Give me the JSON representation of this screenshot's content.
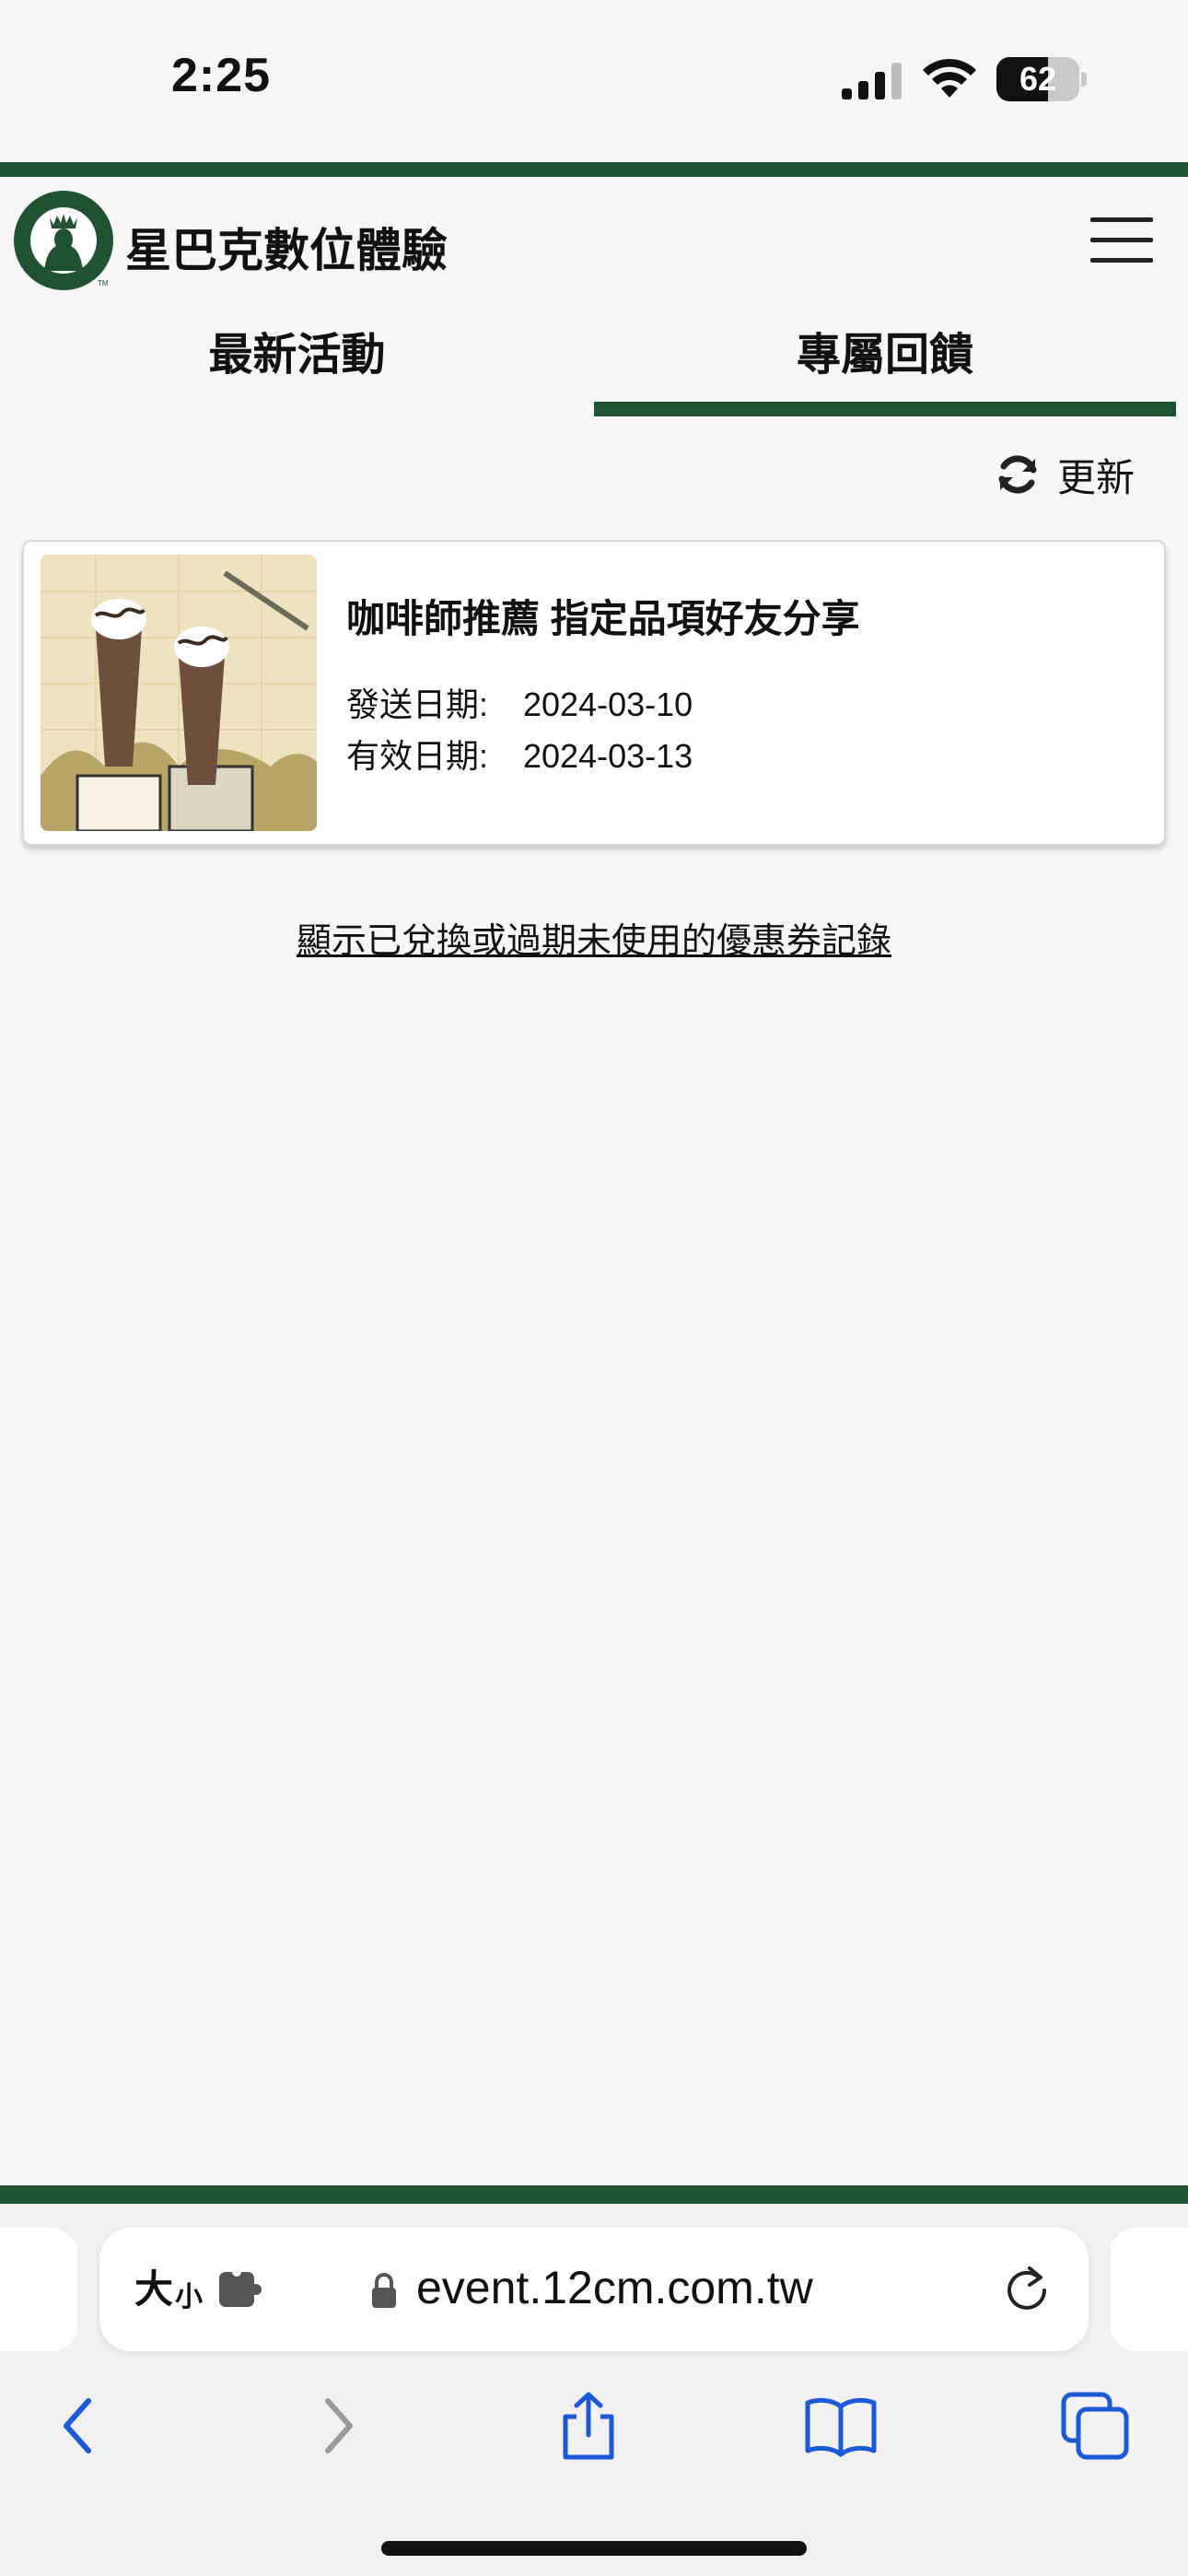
{
  "status_bar": {
    "time": "2:25",
    "battery_level": "62",
    "battery_fraction": 0.62
  },
  "header": {
    "site_title": "星巴克數位體驗",
    "menu_icon": "hamburger-menu-icon",
    "brand_color": "#1e5230"
  },
  "tabs": [
    {
      "label": "最新活動",
      "active": false
    },
    {
      "label": "專屬回饋",
      "active": true
    }
  ],
  "refresh": {
    "label": "更新",
    "icon": "refresh-icon"
  },
  "coupons": [
    {
      "title": "咖啡師推薦 指定品項好友分享",
      "sent_label": "發送日期:",
      "sent_date": "2024-03-10",
      "valid_label": "有效日期:",
      "valid_date": "2024-03-13",
      "image": "frappuccino-drinks-illustration"
    }
  ],
  "history_link": "顯示已兌換或過期未使用的優惠券記錄",
  "browser": {
    "text_size_big": "大",
    "text_size_small": "小",
    "url": "event.12cm.com.tw",
    "toolbar_icons": [
      "back-icon",
      "forward-icon",
      "share-icon",
      "bookmarks-icon",
      "tabs-icon"
    ]
  }
}
